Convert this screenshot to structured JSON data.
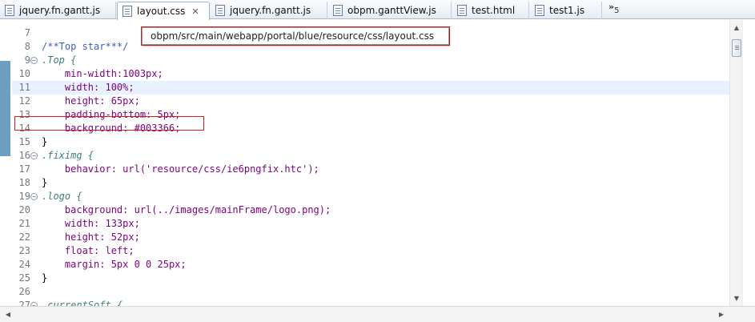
{
  "tabs": [
    {
      "label": "jquery.fn.gantt.js",
      "active": false
    },
    {
      "label": "layout.css",
      "active": true,
      "close": "✕"
    },
    {
      "label": "jquery.fn.gantt.js",
      "active": false
    },
    {
      "label": "obpm.ganttView.js",
      "active": false
    },
    {
      "label": "test.html",
      "active": false
    },
    {
      "label": "test1.js",
      "active": false
    }
  ],
  "overflow": {
    "glyph": "»",
    "count": "5"
  },
  "tooltip": {
    "text": "obpm/src/main/webapp/portal/blue/resource/css/layout.css"
  },
  "code_lines": [
    {
      "num": "7",
      "text": ""
    },
    {
      "num": "8",
      "text": "/**Top star***/"
    },
    {
      "num": "9",
      "text": ".Top {"
    },
    {
      "num": "10",
      "text": "    min-width:1003px;"
    },
    {
      "num": "11",
      "text": "    width: 100%;"
    },
    {
      "num": "12",
      "text": "    height: 65px;"
    },
    {
      "num": "13",
      "text": "    padding-bottom: 5px;"
    },
    {
      "num": "14",
      "text": "    background: #003366;"
    },
    {
      "num": "15",
      "text": "}"
    },
    {
      "num": "16",
      "text": ".fiximg {"
    },
    {
      "num": "17",
      "text": "    behavior: url('resource/css/ie6pngfix.htc');"
    },
    {
      "num": "18",
      "text": "}"
    },
    {
      "num": "19",
      "text": ".logo {"
    },
    {
      "num": "20",
      "text": "    background: url(../images/mainFrame/logo.png);"
    },
    {
      "num": "21",
      "text": "    width: 133px;"
    },
    {
      "num": "22",
      "text": "    height: 52px;"
    },
    {
      "num": "23",
      "text": "    float: left;"
    },
    {
      "num": "24",
      "text": "    margin: 5px 0 0 25px;"
    },
    {
      "num": "25",
      "text": "}"
    },
    {
      "num": "26",
      "text": ""
    },
    {
      "num": "27",
      "text": ".currentSoft {"
    }
  ],
  "colors": {
    "comment": "#3f5fbf",
    "selector": "#3f7f7f",
    "property": "#7f007f",
    "value": "#2a00ff",
    "current_line": "#e8f2fe",
    "annotation_box": "#d02020",
    "change_bar": "#6e9fc2"
  }
}
